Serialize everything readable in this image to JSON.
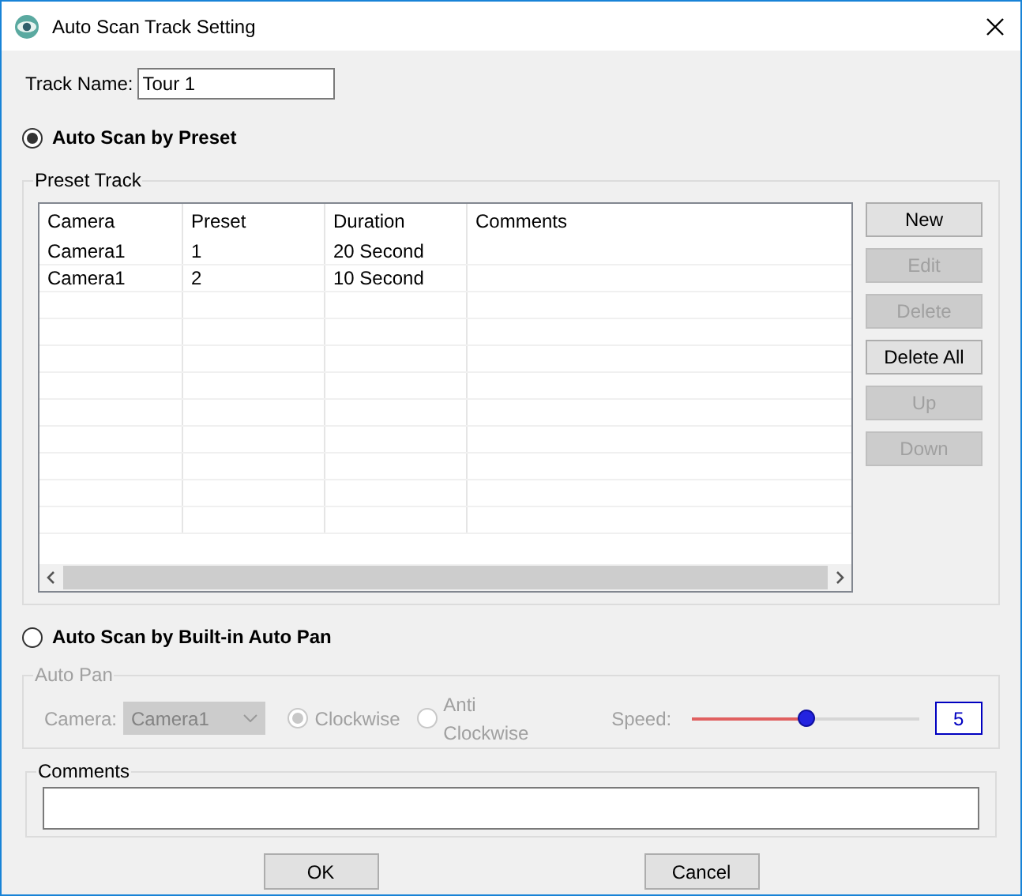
{
  "window": {
    "title": "Auto Scan Track Setting"
  },
  "track_name": {
    "label": "Track Name:",
    "value": "Tour 1"
  },
  "modes": [
    {
      "label": "Auto Scan by Preset",
      "selected": true
    },
    {
      "label": "Auto Scan by Built-in Auto Pan",
      "selected": false
    }
  ],
  "preset_track": {
    "title": "Preset Track",
    "columns": [
      "Camera",
      "Preset",
      "Duration",
      "Comments"
    ],
    "rows": [
      [
        "Camera1",
        "1",
        "20 Second",
        ""
      ],
      [
        "Camera1",
        "2",
        "10 Second",
        ""
      ]
    ],
    "buttons": [
      {
        "label": "New",
        "disabled": false
      },
      {
        "label": "Edit",
        "disabled": true
      },
      {
        "label": "Delete",
        "disabled": true
      },
      {
        "label": "Delete All",
        "disabled": false
      },
      {
        "label": "Up",
        "disabled": true
      },
      {
        "label": "Down",
        "disabled": true
      }
    ]
  },
  "auto_pan": {
    "title": "Auto Pan",
    "disabled": true,
    "camera_label": "Camera:",
    "camera_value": "Camera1",
    "directions": [
      {
        "label": "Clockwise",
        "selected": true
      },
      {
        "label": "Anti Clockwise",
        "selected": false
      }
    ],
    "speed_label": "Speed:",
    "level": 0.5,
    "speed_value": "5"
  },
  "comments": {
    "title": "Comments"
  },
  "buttons": [
    "OK",
    "Cancel"
  ]
}
